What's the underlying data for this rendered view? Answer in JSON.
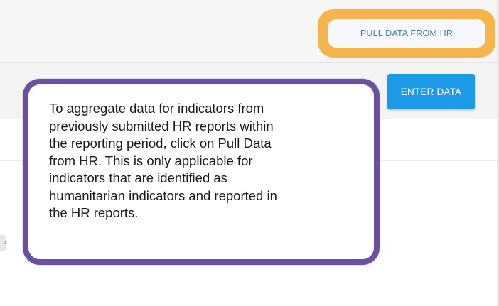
{
  "toolbar": {
    "pull_label": "PULL DATA FROM HR",
    "enter_label": "ENTER DATA"
  },
  "callout": {
    "text": "To aggregate data for indicators from\npreviously submitted HR reports  within\nthe reporting period, click on  Pull Data\nfrom HR. This is only applicable for\nindicators that are identified as\nhumanitarian indicators and reported in\nthe HR reports."
  },
  "side": {
    "chip_glyph": "›"
  },
  "colors": {
    "highlight_orange": "#f6b44c",
    "callout_purple": "#6b4fa3",
    "button_blue": "#1e9be8",
    "link_blue": "#3f82b7"
  }
}
